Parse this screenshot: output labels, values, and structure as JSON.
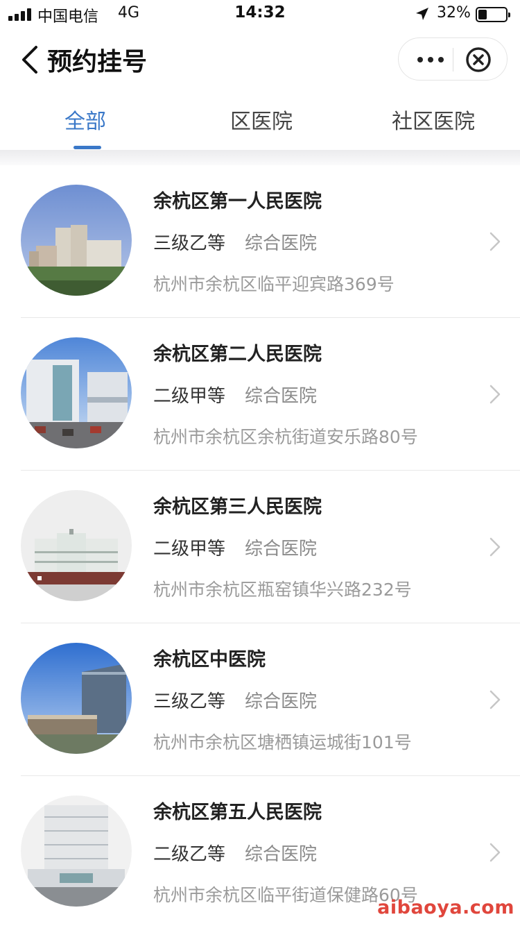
{
  "status_bar": {
    "carrier": "中国电信",
    "network": "4G",
    "time": "14:32",
    "battery": "32%",
    "battery_level": 0.32
  },
  "nav": {
    "title": "预约挂号",
    "back_icon": "chevron-left-icon",
    "more_icon": "more-dots-icon",
    "close_icon": "close-circle-icon"
  },
  "tabs": [
    {
      "label": "全部",
      "active": true
    },
    {
      "label": "区医院",
      "active": false
    },
    {
      "label": "社区医院",
      "active": false
    }
  ],
  "hospitals": [
    {
      "name": "余杭区第一人民医院",
      "level": "三级乙等",
      "type": "综合医院",
      "address": "杭州市余杭区临平迎宾路369号"
    },
    {
      "name": "余杭区第二人民医院",
      "level": "二级甲等",
      "type": "综合医院",
      "address": "杭州市余杭区余杭街道安乐路80号"
    },
    {
      "name": "余杭区第三人民医院",
      "level": "二级甲等",
      "type": "综合医院",
      "address": "杭州市余杭区瓶窑镇华兴路232号"
    },
    {
      "name": "余杭区中医院",
      "level": "三级乙等",
      "type": "综合医院",
      "address": "杭州市余杭区塘栖镇运城街101号"
    },
    {
      "name": "余杭区第五人民医院",
      "level": "二级乙等",
      "type": "综合医院",
      "address": "杭州市余杭区临平街道保健路60号"
    }
  ],
  "watermark": "aibaoya.com",
  "colors": {
    "accent": "#3a78c8",
    "watermark": "#e0463c"
  }
}
